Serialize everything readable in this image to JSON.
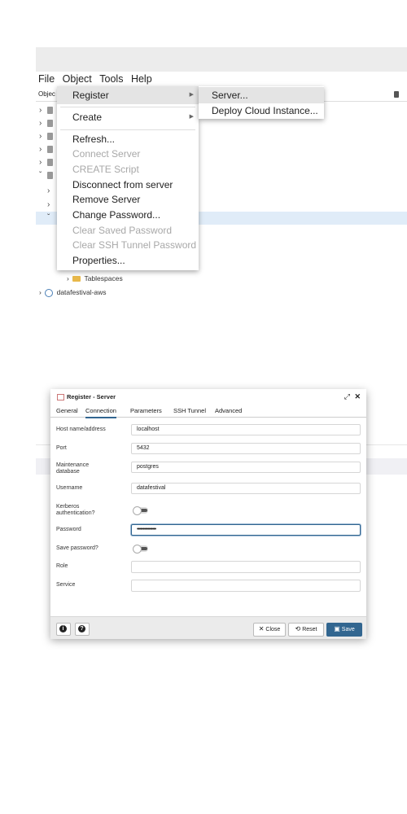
{
  "menubar": {
    "items": [
      "File",
      "Object",
      "Tools",
      "Help"
    ]
  },
  "browser": {
    "header_label": "Objec",
    "tablespaces_label": "Tablespaces",
    "server_label": "datafestival-aws"
  },
  "object_menu": {
    "items": [
      {
        "label": "Register",
        "disabled": false,
        "submenu": true,
        "highlighted": true
      },
      {
        "label": "Create",
        "disabled": false,
        "submenu": true
      },
      {
        "label": "Refresh...",
        "disabled": false
      },
      {
        "label": "Connect Server",
        "disabled": true
      },
      {
        "label": "CREATE Script",
        "disabled": true
      },
      {
        "label": "Disconnect from server",
        "disabled": false
      },
      {
        "label": "Remove Server",
        "disabled": false
      },
      {
        "label": "Change Password...",
        "disabled": false
      },
      {
        "label": "Clear Saved Password",
        "disabled": true
      },
      {
        "label": "Clear SSH Tunnel Password",
        "disabled": true
      },
      {
        "label": "Properties...",
        "disabled": false
      }
    ]
  },
  "register_submenu": {
    "items": [
      {
        "label": "Server...",
        "highlighted": true
      },
      {
        "label": "Deploy Cloud Instance..."
      }
    ]
  },
  "dialog": {
    "title": "Register - Server",
    "expand_icon": "⤢",
    "close_icon": "✕",
    "tabs": [
      "General",
      "Connection",
      "Parameters",
      "SSH Tunnel",
      "Advanced"
    ],
    "active_tab": "Connection",
    "fields": {
      "host": {
        "label": "Host name/address",
        "value": "localhost"
      },
      "port": {
        "label": "Port",
        "value": "5432"
      },
      "maintenance_db": {
        "label": "Maintenance database",
        "value": "postgres"
      },
      "username": {
        "label": "Username",
        "value": "datafestival"
      },
      "kerberos": {
        "label": "Kerberos authentication?",
        "value": "off"
      },
      "password": {
        "label": "Password",
        "value": "••••••••••••••••"
      },
      "save_password": {
        "label": "Save password?",
        "value": "off"
      },
      "role": {
        "label": "Role",
        "value": ""
      },
      "service": {
        "label": "Service",
        "value": ""
      }
    },
    "footer": {
      "info_glyph": "i",
      "help_glyph": "?",
      "close_label": "Close",
      "reset_label": "Reset",
      "save_label": "Save"
    }
  },
  "colors": {
    "accent": "#326690",
    "highlight": "#e4e4e4",
    "selected_row": "#e0ecf8"
  }
}
